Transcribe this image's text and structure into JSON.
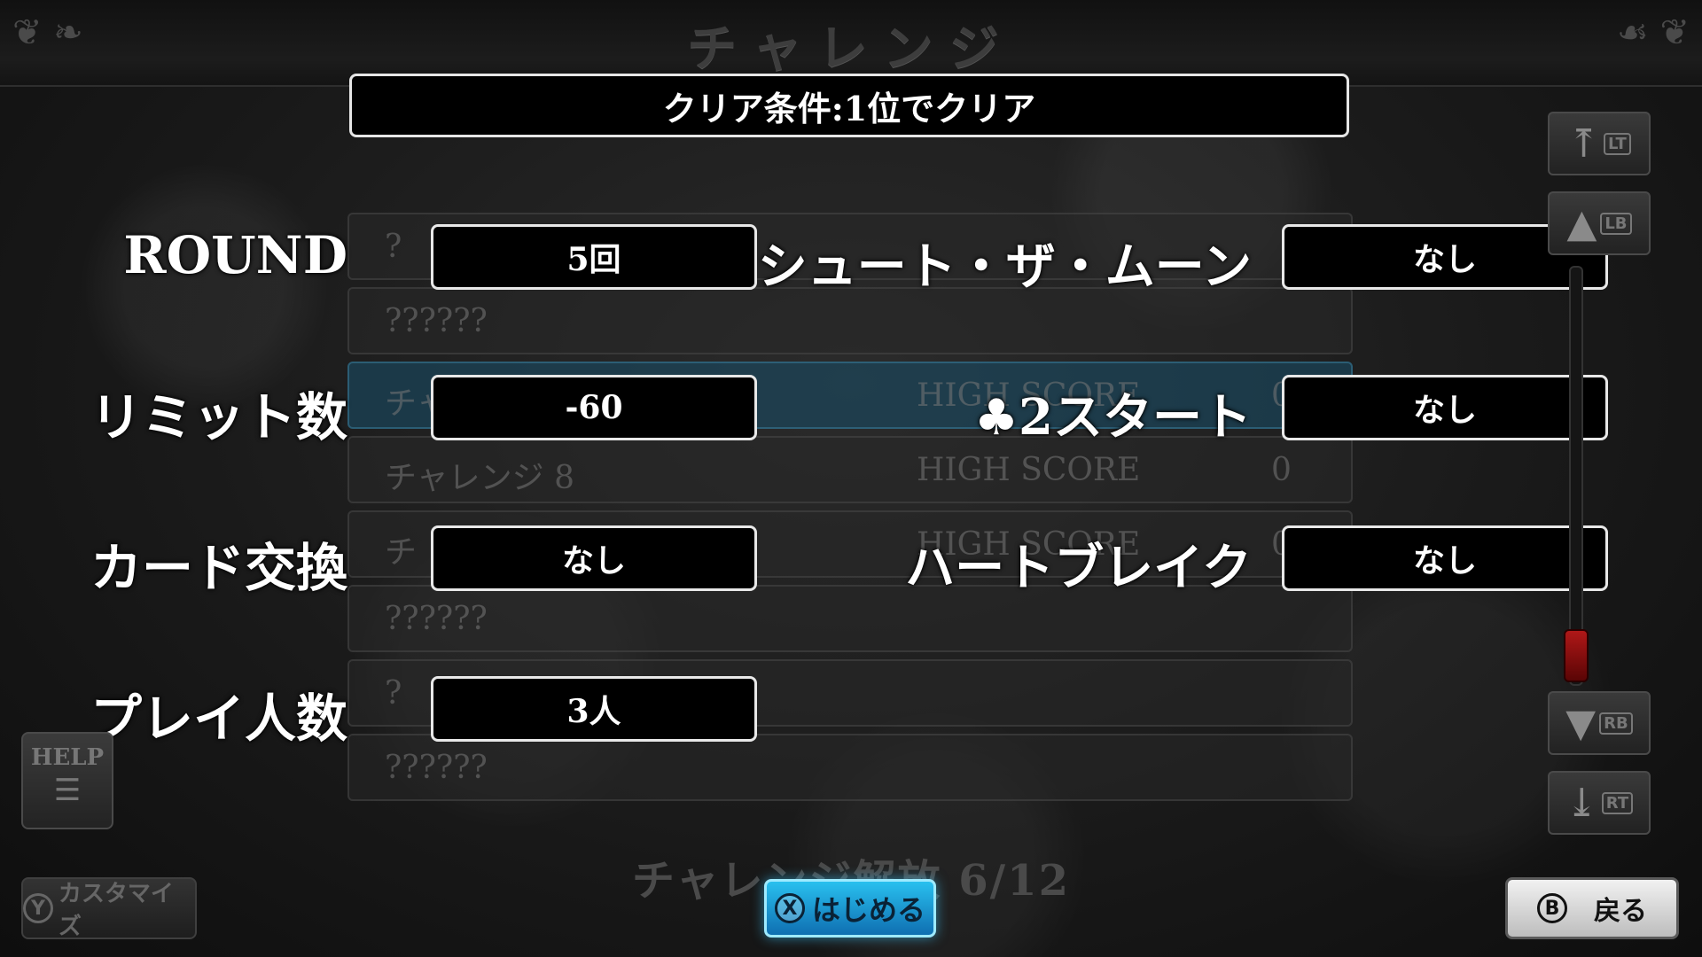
{
  "header": {
    "title": "チャレンジ"
  },
  "clear_condition": "クリア条件:1位でクリア",
  "background_list": [
    {
      "name": "?",
      "score_label": "",
      "score": ""
    },
    {
      "name": "??????",
      "score_label": "",
      "score": ""
    },
    {
      "name": "チャレンジ 7",
      "score_label": "HIGH SCORE",
      "score": "0"
    },
    {
      "name": "チャレンジ 8",
      "score_label": "HIGH SCORE",
      "score": "0"
    },
    {
      "name": "チ",
      "score_label": "HIGH SCORE",
      "score": "0"
    },
    {
      "name": "??????",
      "score_label": "",
      "score": ""
    },
    {
      "name": "?",
      "score_label": "",
      "score": ""
    },
    {
      "name": "??????",
      "score_label": "",
      "score": ""
    }
  ],
  "settings": {
    "round": {
      "label": "ROUND",
      "value": "5回"
    },
    "limit": {
      "label": "リミット数",
      "value": "-60"
    },
    "card_exchange": {
      "label": "カード交換",
      "value": "なし"
    },
    "players": {
      "label": "プレイ人数",
      "value": "3人"
    },
    "shoot_the_moon": {
      "label": "シュート・ザ・ムーン",
      "value": "なし"
    },
    "club_two_start": {
      "label": "♣2スタート",
      "value": "なし"
    },
    "heart_break": {
      "label": "ハートブレイク",
      "value": "なし"
    }
  },
  "nav": {
    "lt": "LT",
    "lb": "LB",
    "rb": "RB",
    "rt": "RT"
  },
  "help": {
    "label": "HELP"
  },
  "customize": {
    "key": "Y",
    "label": "カスタマイズ"
  },
  "unlock_status": "チャレンジ解放 6/12",
  "start": {
    "key": "X",
    "label": "はじめる"
  },
  "back": {
    "key": "B",
    "label": "戻る"
  },
  "colors": {
    "start_button": "#1f9fd8",
    "scroll_thumb": "#a01515"
  }
}
